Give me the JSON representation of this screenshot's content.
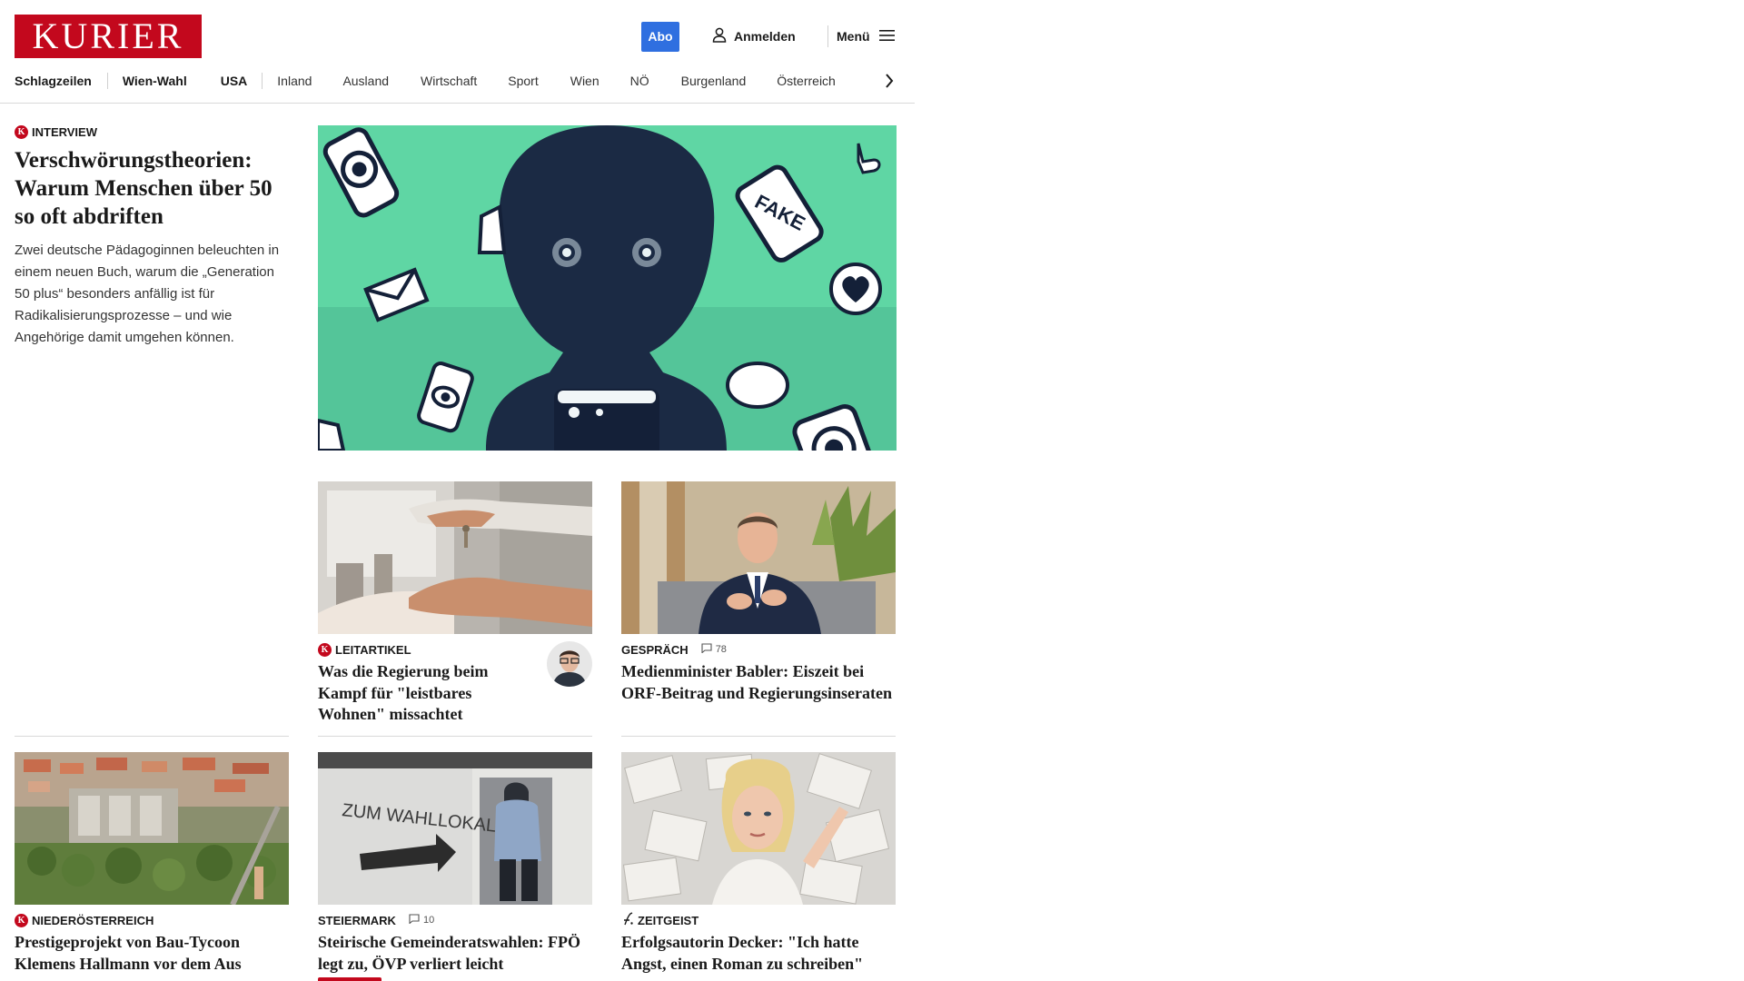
{
  "brand": {
    "logo_text": "KURIER",
    "color": "#c3081d"
  },
  "header": {
    "abo_label": "Abo",
    "login_label": "Anmelden",
    "menu_label": "Menü",
    "accent": "#2f6fe0"
  },
  "nav": {
    "items": [
      "Schlagzeilen",
      "Wien-Wahl",
      "USA",
      "Inland",
      "Ausland",
      "Wirtschaft",
      "Sport",
      "Wien",
      "NÖ",
      "Burgenland",
      "Österreich"
    ]
  },
  "lead": {
    "category": "INTERVIEW",
    "title": "Verschwörungstheorien: Warum Menschen über 50 so oft abdriften",
    "teaser": "Zwei deutsche Pädagoginnen beleuchten in einem neuen Buch, warum die „Generation 50 plus“ besonders anfällig ist für Radikalisierungsprozesse – und wie Angehörige damit umgehen können.",
    "image_word": "FAKE"
  },
  "cards": [
    {
      "category": "LEITARTIKEL",
      "title": "Was die Regierung beim Kampf für \"leistbares Wohnen\" missachtet",
      "icon": "kurier-k-icon"
    },
    {
      "category": "GESPRÄCH",
      "comments": "78",
      "title": "Medienminister Babler: Eiszeit bei ORF-Beitrag und Regierungsinseraten"
    },
    {
      "category": "NIEDERÖSTERREICH",
      "title": "Prestigeprojekt von Bau-Tycoon Klemens Hallmann vor dem Aus",
      "icon": "kurier-k-icon"
    },
    {
      "category": "STEIERMARK",
      "comments": "10",
      "title": "Steirische Gemeinderatswahlen: FPÖ legt zu, ÖVP verliert leicht",
      "image_text": "ZUM WAHLLOKAL"
    },
    {
      "category": "ZEITGEIST",
      "title": "Erfolgsautorin Decker: \"Ich hatte Angst, einen Roman zu schreiben\"",
      "icon": "zeitgeist-icon"
    }
  ]
}
